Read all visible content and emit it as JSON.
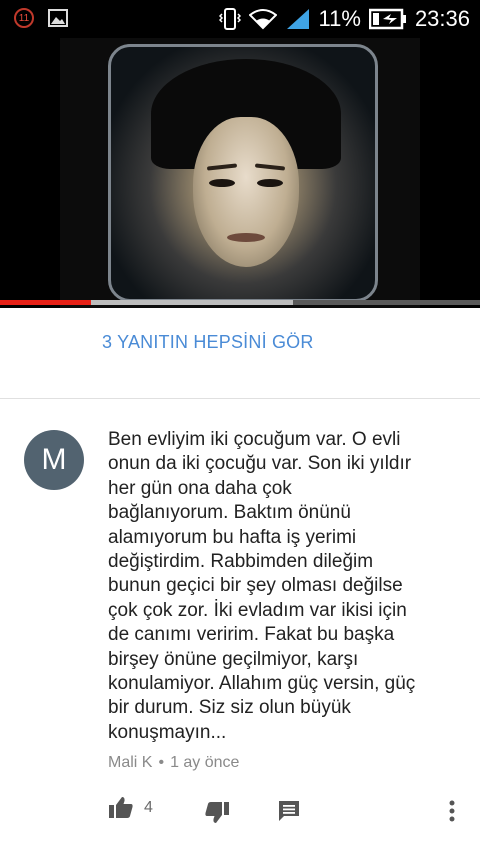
{
  "status_bar": {
    "notification_count": "11",
    "battery_percent": "11%",
    "time": "23:36",
    "icons": [
      "notification-badge-icon",
      "image-icon",
      "vibrate-icon",
      "wifi-icon",
      "signal-icon",
      "battery-charging-icon"
    ]
  },
  "video": {
    "progress_played_fraction": 0.19,
    "progress_buffered_fraction": 0.61,
    "colors": {
      "played": "#e62117",
      "buffered": "#bdbdbd",
      "track": "#5a5a5a"
    }
  },
  "replies": {
    "view_all_label": "3 YANITIN HEPSİNİ GÖR",
    "accent_color": "#4a8bd6"
  },
  "comment": {
    "avatar_letter": "M",
    "avatar_color": "#526370",
    "text": "Ben evliyim iki çocuğum var. O evli\nonun da iki çocuğu var. Son iki yıldır\nher  gün ona daha çok\nbağlanıyorum. Baktım önünü\nalamıyorum bu hafta iş yerimi\ndeğiştirdim. Rabbimden dileğim\nbunun geçici bir şey olması değilse\nçok çok zor. İki evladım var ikisi için\nde canımı veririm. Fakat bu başka\nbirşey önüne geçilmiyor, karşı\nkonulamiyor. Allahım güç versin, güç\nbir durum. Siz siz olun büyük\nkonuşmayın...",
    "author": "Mali K",
    "separator": "•",
    "time_ago": "1 ay önce",
    "like_count": "4"
  }
}
